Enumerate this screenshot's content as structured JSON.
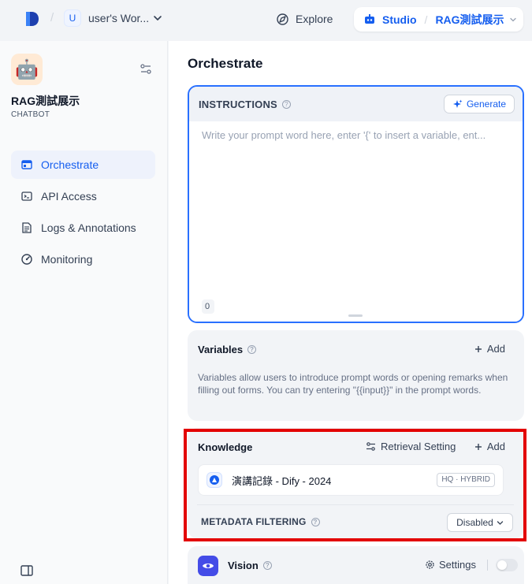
{
  "topbar": {
    "workspace_initial": "U",
    "workspace_name": "user's Wor...",
    "explore_label": "Explore",
    "studio_label": "Studio",
    "app_selector": "RAG測試展示"
  },
  "sidebar": {
    "app_name": "RAG測試展示",
    "app_type": "CHATBOT",
    "items": [
      {
        "label": "Orchestrate",
        "icon": "layout-icon"
      },
      {
        "label": "API Access",
        "icon": "terminal-icon"
      },
      {
        "label": "Logs & Annotations",
        "icon": "document-icon"
      },
      {
        "label": "Monitoring",
        "icon": "dashboard-icon"
      }
    ]
  },
  "main": {
    "title": "Orchestrate",
    "instructions": {
      "label": "INSTRUCTIONS",
      "generate_label": "Generate",
      "placeholder": "Write your prompt word here, enter '{' to insert a variable, ent...",
      "char_count": "0"
    },
    "variables": {
      "label": "Variables",
      "add_label": "Add",
      "description": "Variables allow users to introduce prompt words or opening remarks when filling out forms. You can try entering \"{{input}}\" in the prompt words."
    },
    "knowledge": {
      "label": "Knowledge",
      "retrieval_label": "Retrieval Setting",
      "add_label": "Add",
      "item_name": "演講記錄 - Dify - 2024",
      "item_badge": "HQ · HYBRID",
      "metadata_label": "METADATA FILTERING",
      "metadata_value": "Disabled"
    },
    "vision": {
      "label": "Vision",
      "settings_label": "Settings"
    }
  },
  "colors": {
    "accent": "#155eef",
    "highlight": "#e30000",
    "vision_icon_bg": "#444ce7"
  }
}
